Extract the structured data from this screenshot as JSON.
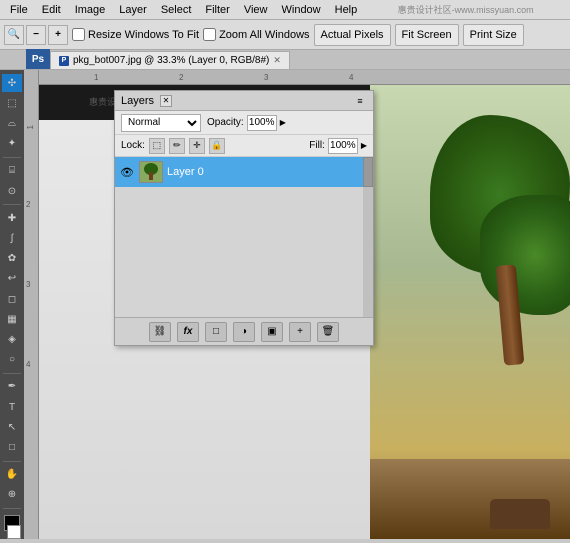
{
  "menubar": {
    "items": [
      "File",
      "Edit",
      "Image",
      "Layer",
      "Select",
      "Filter",
      "View",
      "Window",
      "Help"
    ]
  },
  "toolbar": {
    "zoom_icon": "🔍",
    "zoom_out_icon": "−",
    "zoom_in_icon": "+",
    "resize_windows_label": "Resize Windows To Fit",
    "zoom_all_label": "Zoom All Windows",
    "actual_pixels_label": "Actual Pixels",
    "fit_screen_label": "Fit Screen",
    "print_size_label": "Print Size"
  },
  "document": {
    "tab_title": "pkg_bot007.jpg @ 33.3% (Layer 0, RGB/8#)"
  },
  "canvas": {
    "watermark": "www.missyuan.com",
    "ruler_marks_h": [
      "1",
      "2",
      "3",
      "4"
    ],
    "ruler_marks_v": [
      "1",
      "2",
      "3",
      "4"
    ]
  },
  "layers_panel": {
    "title": "Layers",
    "blend_mode": "Normal",
    "opacity_label": "Opacity:",
    "opacity_value": "100%",
    "lock_label": "Lock:",
    "fill_label": "Fill:",
    "fill_value": "100%",
    "layers": [
      {
        "name": "Layer 0",
        "visible": true,
        "selected": true
      }
    ],
    "footer_icons": [
      "link-icon",
      "fx-icon",
      "adjustment-icon",
      "mask-icon",
      "group-icon",
      "delete-icon"
    ]
  }
}
